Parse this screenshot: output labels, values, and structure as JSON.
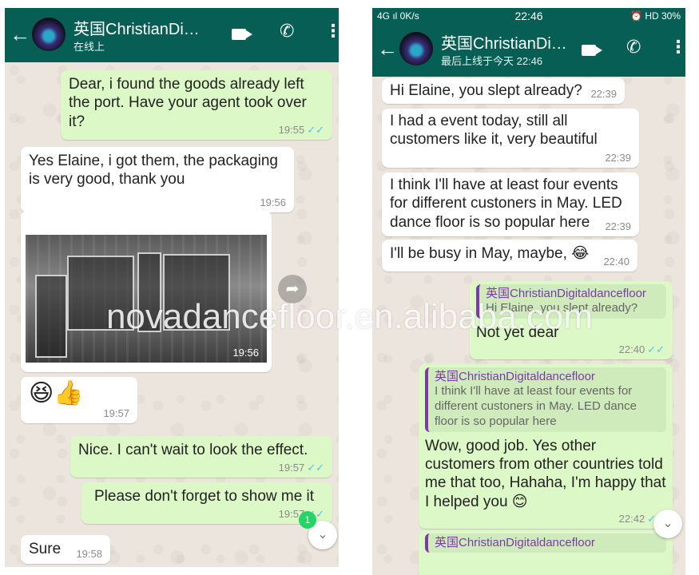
{
  "left_phone": {
    "contact_name": "英国ChristianDi…",
    "contact_status": "在线上",
    "messages": [
      {
        "text": "Dear, i found the goods already left the port. Have your agent took over it?",
        "time": "19:55"
      },
      {
        "text": "Yes Elaine, i got them, the packaging is very good, thank you",
        "time": "19:56"
      },
      {
        "time": "19:56"
      },
      {
        "text": "😆👍",
        "time": "19:57"
      },
      {
        "text": "Nice. I can't wait to look the effect.",
        "time": "19:57"
      },
      {
        "text": "Please don't forget to show me it",
        "time": "19:57"
      },
      {
        "text": "Sure",
        "time": "19:58"
      }
    ],
    "unread_count": "1"
  },
  "right_phone": {
    "status_bar": {
      "left": "4G ıl  0K/s",
      "time": "22:46",
      "right": "⏰ HD 30%"
    },
    "contact_name": "英国ChristianDi…",
    "contact_status": "最后上线于今天 22:46",
    "messages": [
      {
        "text": "Hi Elaine, you slept already?",
        "time": "22:39"
      },
      {
        "text": "I had a event today, still all customers like it, very beautiful",
        "time": "22:39"
      },
      {
        "text": "I think I'll have at least four events for different custoners in May. LED dance floor is so popular here",
        "time": "22:39"
      },
      {
        "text": "I'll be busy in May, maybe, 😂",
        "time": "22:40"
      },
      {
        "quote_author": "英国ChristianDigitaldancefloor",
        "quote_text": "Hi Elaine, you slept already?",
        "text": "Not yet dear",
        "time": "22:40"
      },
      {
        "quote_author": "英国ChristianDigitaldancefloor",
        "quote_text": "I think I'll have at least four events for different custoners in May. LED dance floor is so popular here",
        "text": "Wow,  good job. Yes other customers from other countries told me that too, Hahaha, I'm happy that I helped you 😊",
        "time": "22:42"
      },
      {
        "quote_author": "英国ChristianDigitaldancefloor"
      }
    ]
  },
  "watermark": "novadancefloor.en.alibaba.com",
  "colors": {
    "header": "#075e54",
    "outgoing": "#dcf8c6",
    "incoming": "#ffffff",
    "wallpaper": "#ece5dd",
    "read_tick": "#4fc3f7"
  }
}
